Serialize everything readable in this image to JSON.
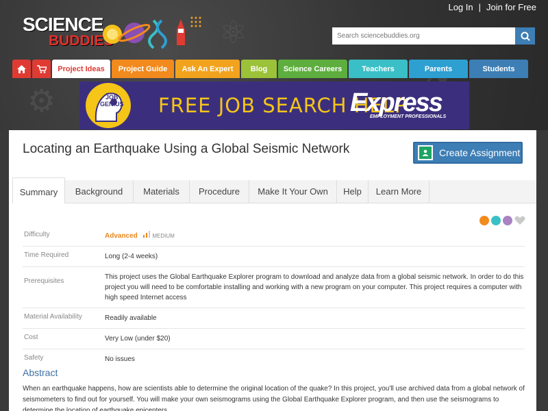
{
  "header": {
    "login": "Log In",
    "separator": "|",
    "join": "Join for Free",
    "logo_line1": "SCIENCE",
    "logo_line2": "BUDDIES",
    "search_placeholder": "Search sciencebuddies.org"
  },
  "nav": {
    "items": [
      {
        "label": "",
        "icon": "home-icon",
        "color": "#e03b33"
      },
      {
        "label": "",
        "icon": "cart-icon",
        "color": "#e03b33"
      },
      {
        "label": "Project Ideas",
        "color": "#ffffff",
        "text": "#e03b33"
      },
      {
        "label": "Project Guide",
        "color": "#f28a1e"
      },
      {
        "label": "Ask An Expert",
        "color": "#f2a31e"
      },
      {
        "label": "Blog",
        "color": "#9cc23a"
      },
      {
        "label": "Science Careers",
        "color": "#5dae3e"
      },
      {
        "label": "Teachers",
        "color": "#3bbfc7"
      },
      {
        "label": "Parents",
        "color": "#2e9fd1"
      },
      {
        "label": "Students",
        "color": "#3d7eb5"
      }
    ]
  },
  "banner": {
    "badge_line1": "JOB",
    "badge_line2": "GENIUS",
    "headline": "FREE JOB SEARCH HELP",
    "brand": "Express",
    "brand_sub": "EMPLOYMENT PROFESSIONALS"
  },
  "page": {
    "title": "Locating an Earthquake Using a Global Seismic Network",
    "create_label": "Create Assignment"
  },
  "tabs": [
    "Summary",
    "Background",
    "Materials",
    "Procedure",
    "Make It Your Own",
    "Help",
    "Learn More"
  ],
  "info": {
    "difficulty_key": "Difficulty",
    "difficulty_value": "Advanced",
    "difficulty_level": "MEDIUM",
    "time_key": "Time Required",
    "time_value": "Long (2-4 weeks)",
    "prereq_key": "Prerequisites",
    "prereq_value": "This project uses the Global Earthquake Explorer program to download and analyze data from a global seismic network. In order to do this project you will need to be comfortable installing and working with a new program on your computer. This project requires a computer with high speed Internet access",
    "material_key": "Material Availability",
    "material_value": "Readily available",
    "cost_key": "Cost",
    "cost_value": "Very Low (under $20)",
    "safety_key": "Safety",
    "safety_value": "No issues"
  },
  "abstract": {
    "heading": "Abstract",
    "text": "When an earthquake happens, how are scientists able to determine the original location of the quake? In this project, you'll use archived data from a global network of seismometers to find out for yourself. You will make your own seismograms using the Global Earthquake Explorer program, and then use the seismograms to determine the location of earthquake epicenters."
  },
  "colors": {
    "accent_blue": "#3d7eb5",
    "difficulty_orange": "#e8861c"
  }
}
